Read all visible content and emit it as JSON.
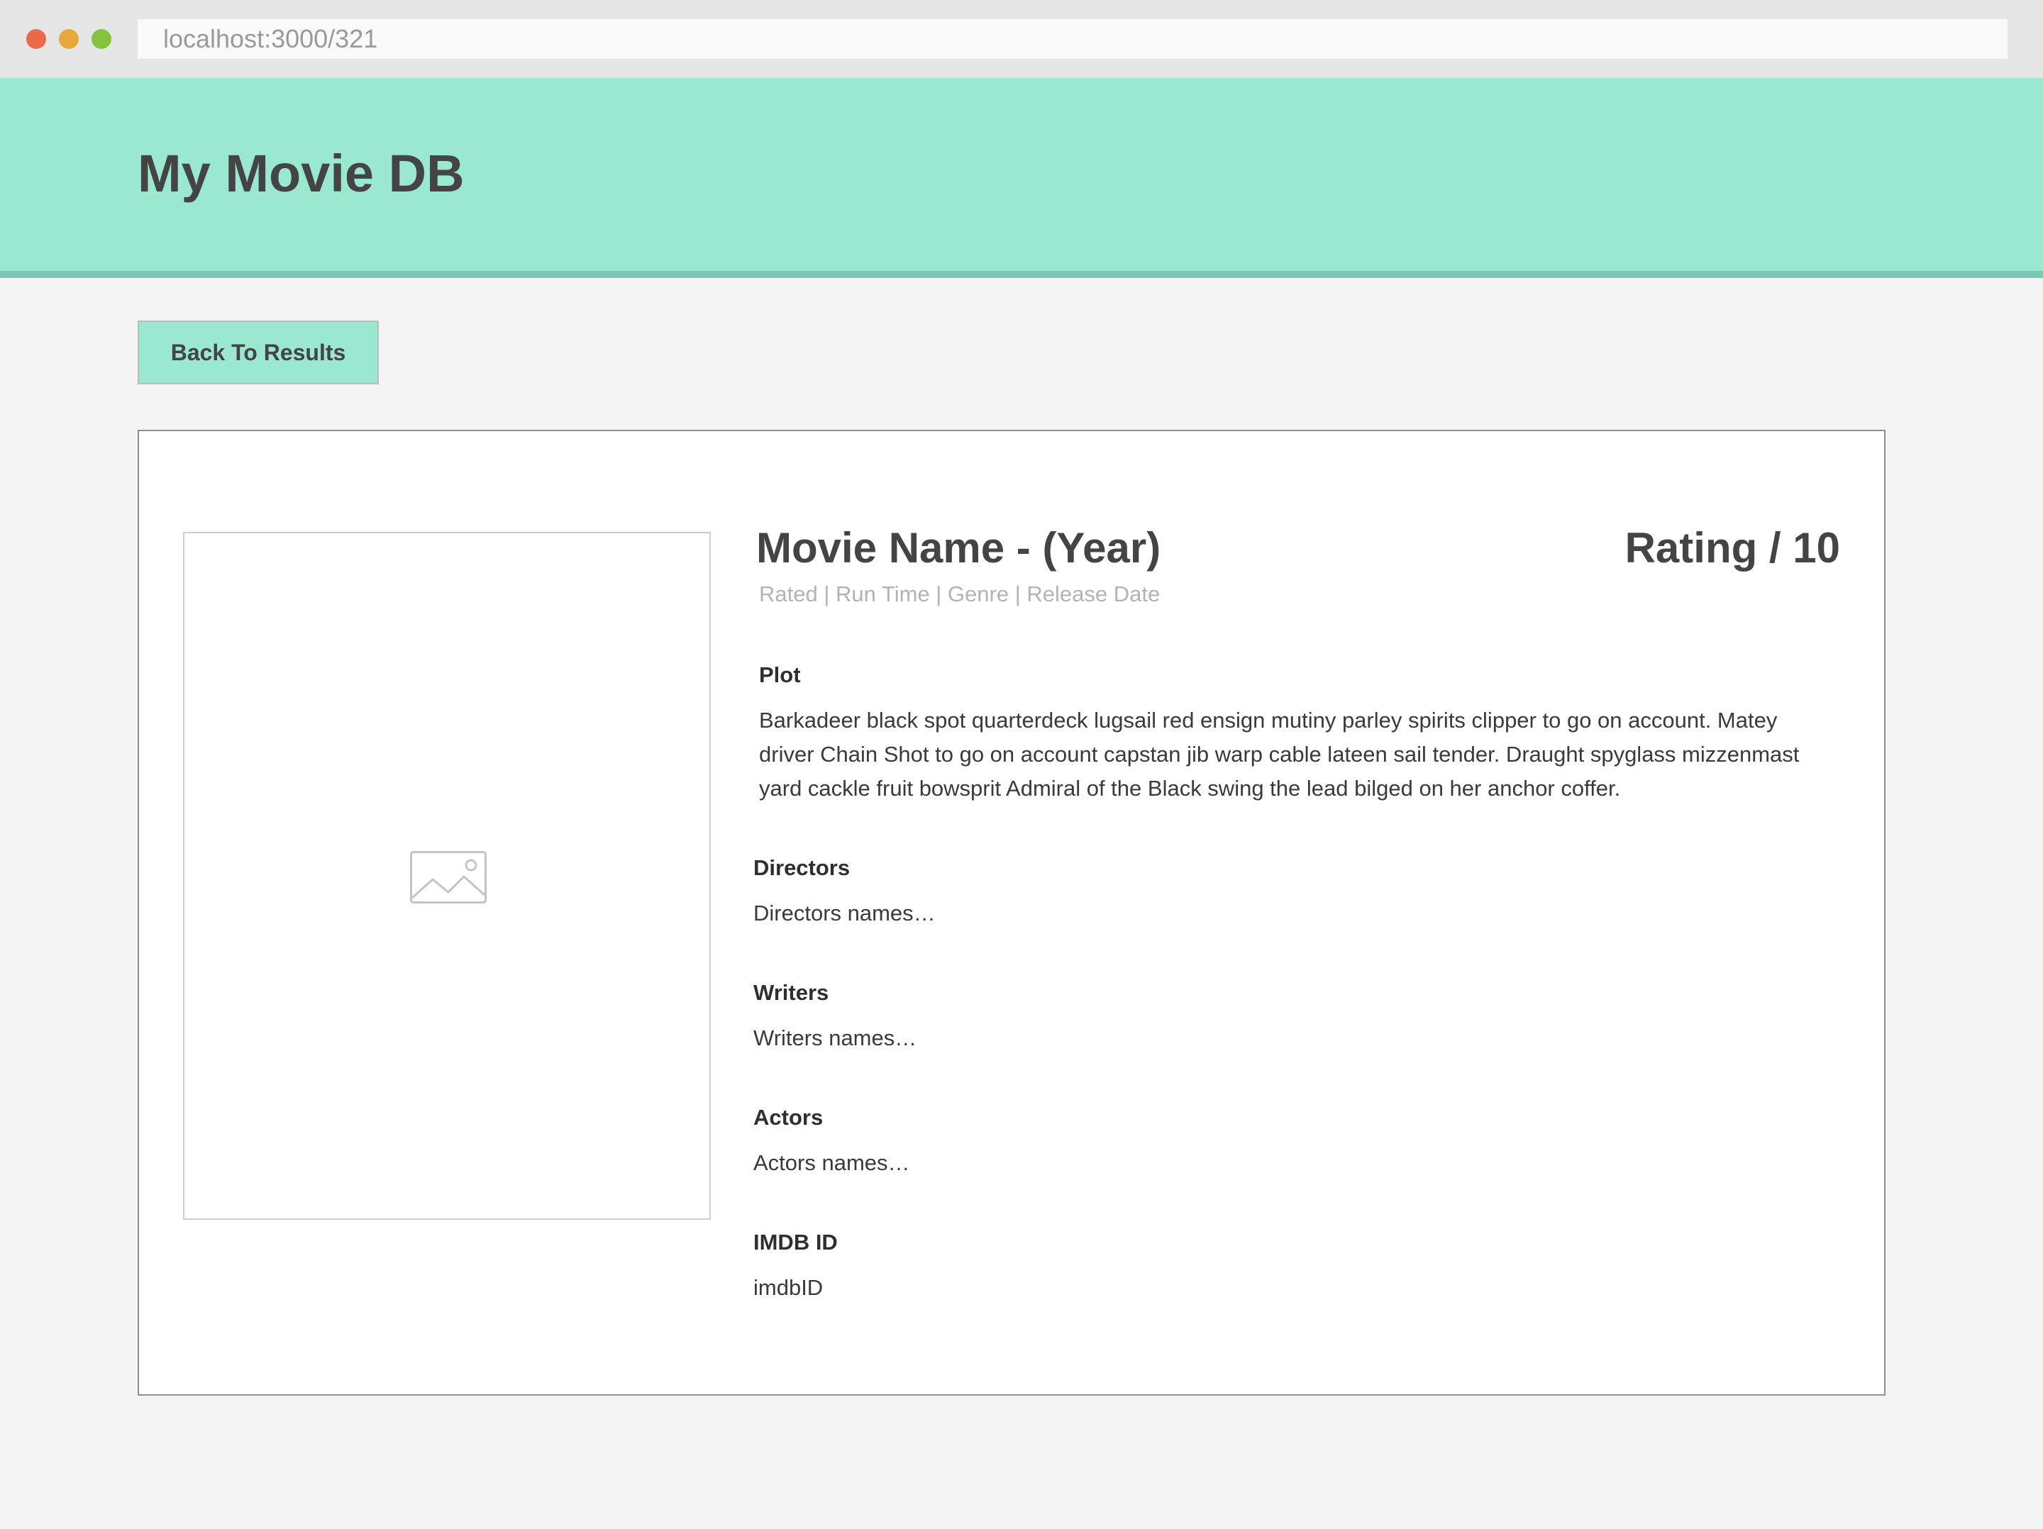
{
  "browser": {
    "url": "localhost:3000/321"
  },
  "header": {
    "title": "My Movie DB"
  },
  "nav": {
    "back_label": "Back To Results"
  },
  "movie": {
    "title": "Movie Name - (Year)",
    "rating": "Rating / 10",
    "meta": "Rated | Run Time | Genre | Release Date",
    "poster_icon": "image-placeholder-icon",
    "plot_label": "Plot",
    "plot": "Barkadeer black spot quarterdeck lugsail red ensign mutiny parley spirits clipper to go on account. Matey driver Chain Shot to go on account capstan jib warp cable lateen sail tender. Draught spyglass mizzenmast yard cackle fruit bowsprit Admiral of the Black swing the lead bilged on her anchor coffer.",
    "directors_label": "Directors",
    "directors": "Directors names…",
    "writers_label": "Writers",
    "writers": "Writers names…",
    "actors_label": "Actors",
    "actors": "Actors names…",
    "imdb_label": "IMDB ID",
    "imdb": "imdbID"
  },
  "colors": {
    "header_bg": "#9ae7d2",
    "header_border": "#7cc9b3",
    "page_bg": "#f4f4f4",
    "traffic_red": "#ec6a4c",
    "traffic_yellow": "#e8a93a",
    "traffic_green": "#84c340"
  }
}
